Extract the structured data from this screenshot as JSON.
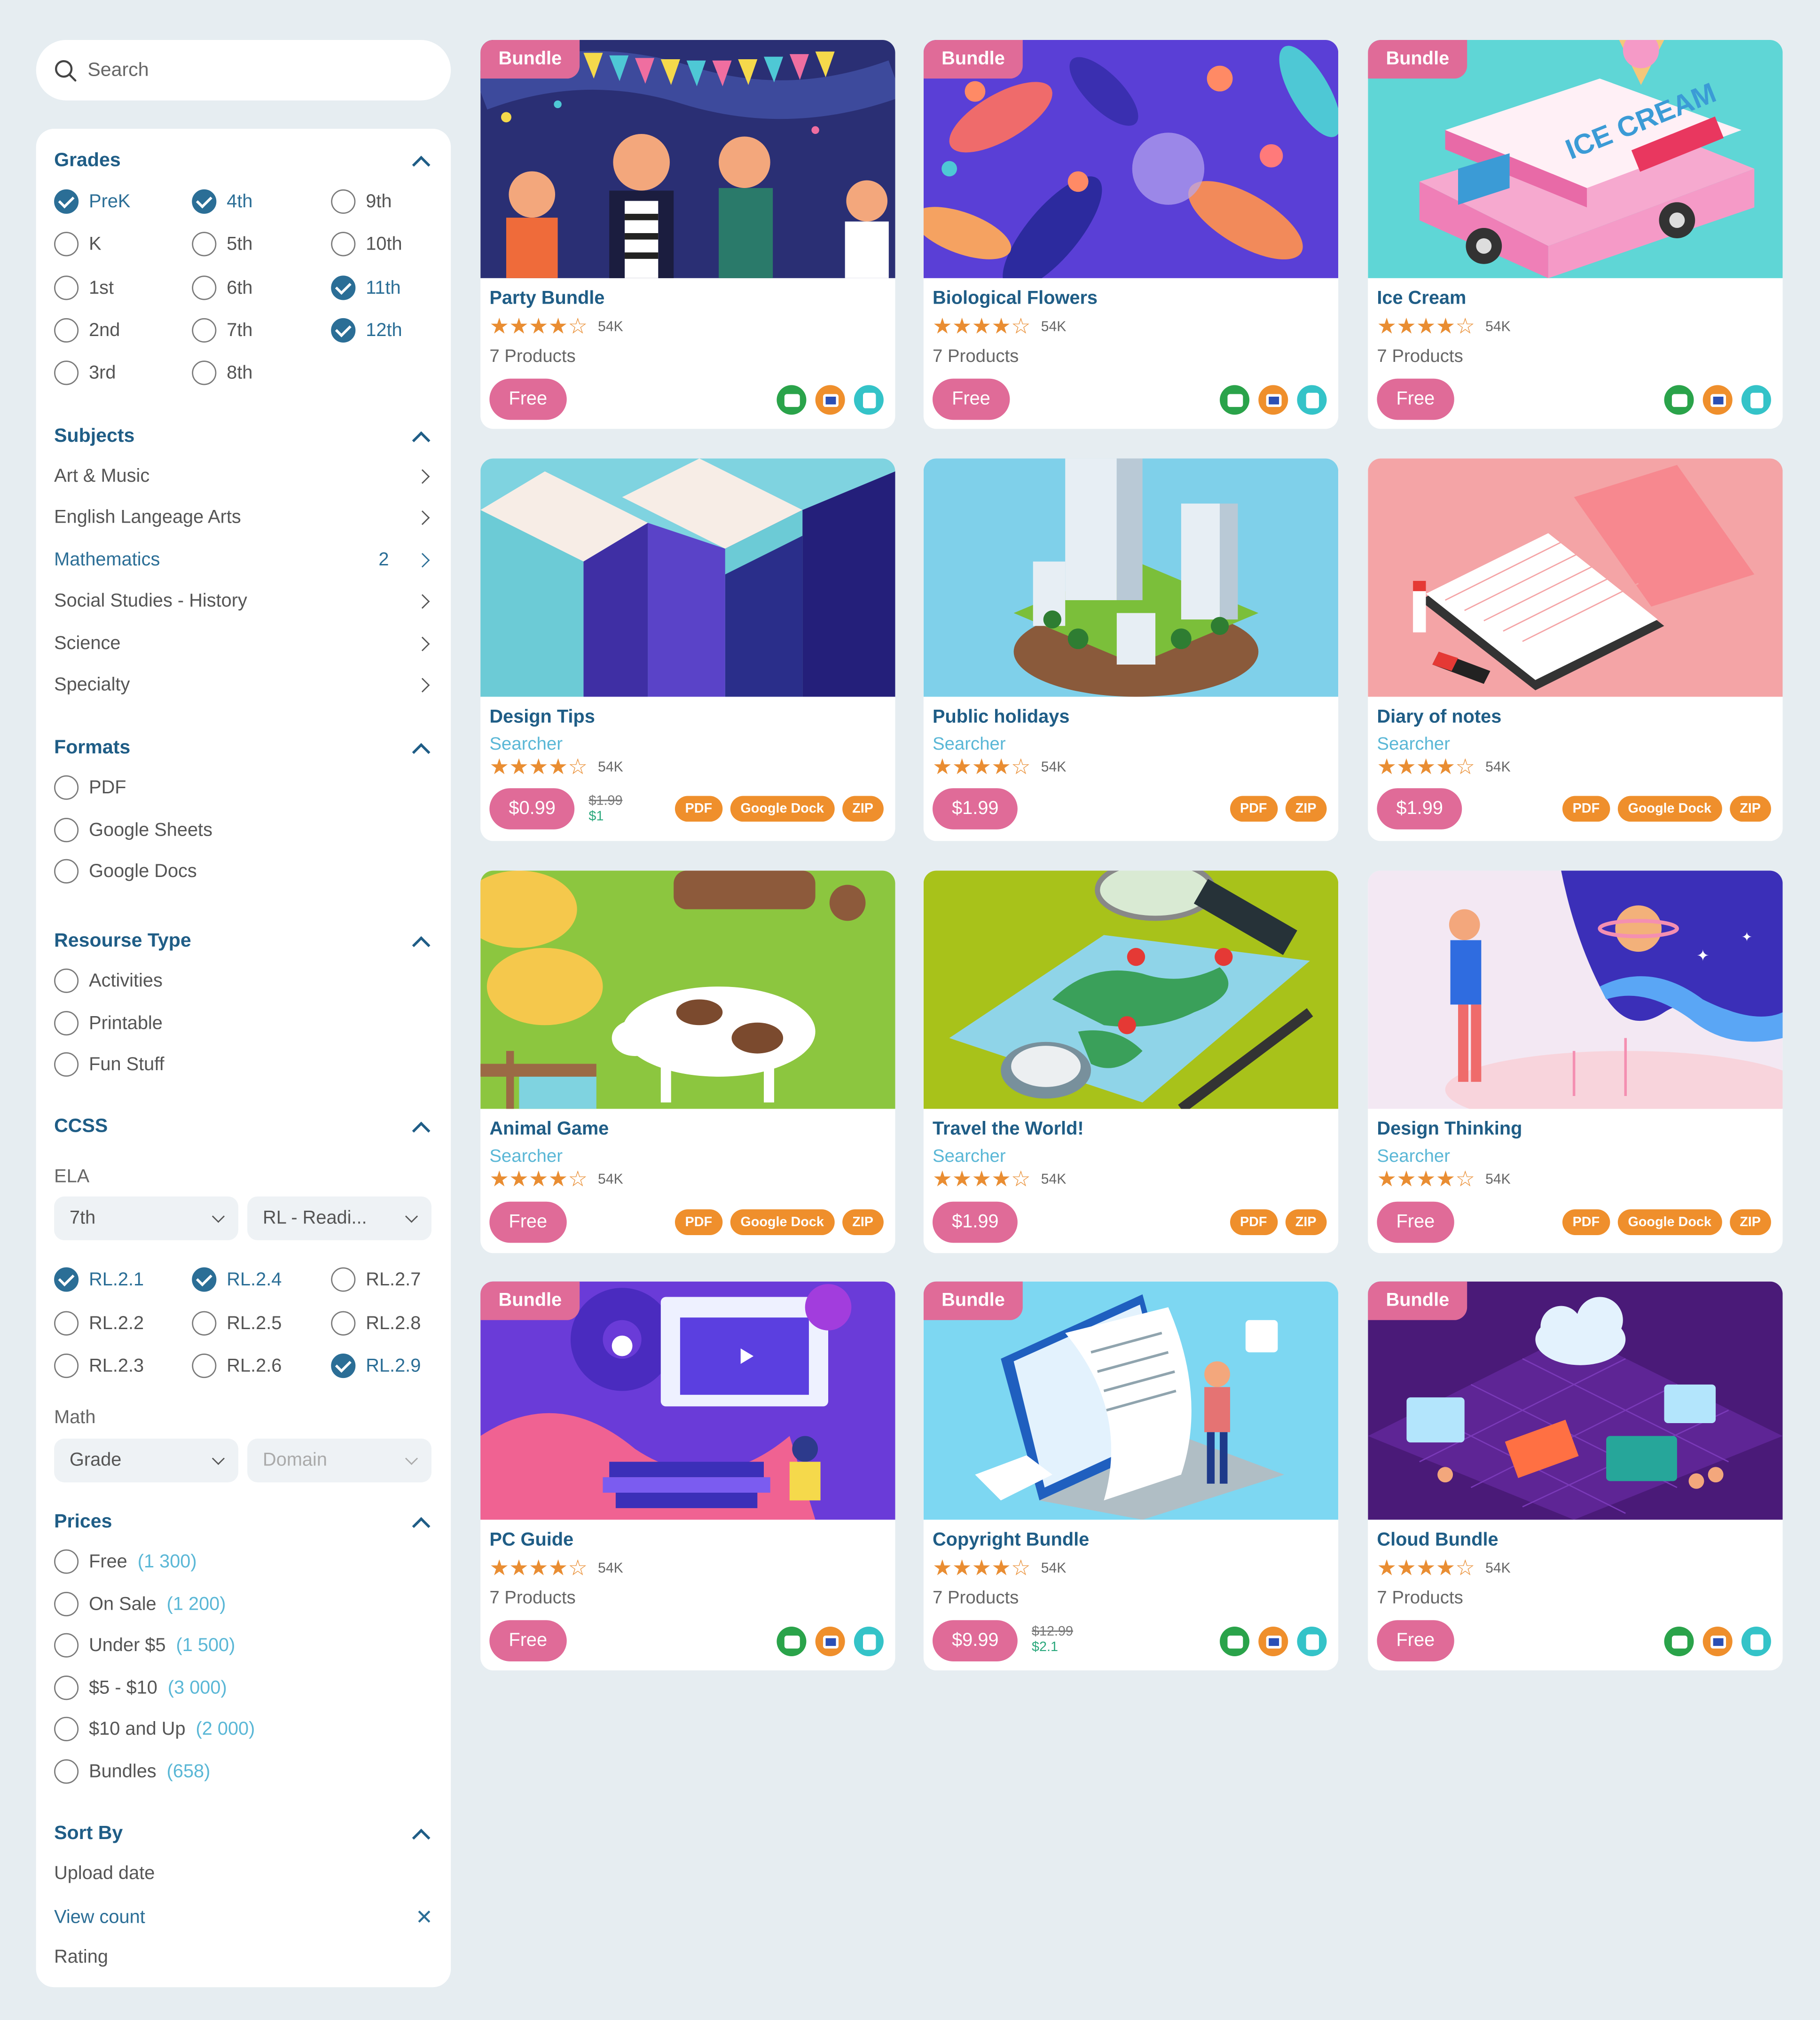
{
  "search": {
    "placeholder": "Search"
  },
  "grades": {
    "title": "Grades",
    "items": [
      {
        "label": "PreK",
        "checked": true
      },
      {
        "label": "K",
        "checked": false
      },
      {
        "label": "1st",
        "checked": false
      },
      {
        "label": "2nd",
        "checked": false
      },
      {
        "label": "3rd",
        "checked": false
      },
      {
        "label": "4th",
        "checked": true
      },
      {
        "label": "5th",
        "checked": false
      },
      {
        "label": "6th",
        "checked": false
      },
      {
        "label": "7th",
        "checked": false
      },
      {
        "label": "8th",
        "checked": false
      },
      {
        "label": "9th",
        "checked": false
      },
      {
        "label": "10th",
        "checked": false
      },
      {
        "label": "11th",
        "checked": true
      },
      {
        "label": "12th",
        "checked": true
      }
    ]
  },
  "subjects": {
    "title": "Subjects",
    "items": [
      {
        "label": "Art & Music",
        "count": ""
      },
      {
        "label": "English Langeage Arts",
        "count": ""
      },
      {
        "label": "Mathematics",
        "count": "2",
        "active": true
      },
      {
        "label": "Social Studies - History",
        "count": ""
      },
      {
        "label": "Science",
        "count": ""
      },
      {
        "label": "Specialty",
        "count": ""
      }
    ]
  },
  "formats": {
    "title": "Formats",
    "items": [
      {
        "label": "PDF"
      },
      {
        "label": "Google Sheets"
      },
      {
        "label": "Google Docs"
      }
    ]
  },
  "resource_type": {
    "title": "Resourse Type",
    "items": [
      {
        "label": "Activities"
      },
      {
        "label": "Printable"
      },
      {
        "label": "Fun Stuff"
      }
    ]
  },
  "ccss": {
    "title": "CCSS",
    "ela_label": "ELA",
    "ela_grade": "7th",
    "ela_domain": "RL - Readi...",
    "items": [
      {
        "label": "RL.2.1",
        "checked": true
      },
      {
        "label": "RL.2.2",
        "checked": false
      },
      {
        "label": "RL.2.3",
        "checked": false
      },
      {
        "label": "RL.2.4",
        "checked": true
      },
      {
        "label": "RL.2.5",
        "checked": false
      },
      {
        "label": "RL.2.6",
        "checked": false
      },
      {
        "label": "RL.2.7",
        "checked": false
      },
      {
        "label": "RL.2.8",
        "checked": false
      },
      {
        "label": "RL.2.9",
        "checked": true
      }
    ],
    "math_label": "Math",
    "math_grade": "Grade",
    "math_domain": "Domain"
  },
  "prices": {
    "title": "Prices",
    "items": [
      {
        "label": "Free",
        "count": "(1 300)"
      },
      {
        "label": "On Sale",
        "count": "(1 200)"
      },
      {
        "label": "Under $5",
        "count": "(1 500)"
      },
      {
        "label": "$5 - $10",
        "count": "(3 000)"
      },
      {
        "label": "$10 and Up",
        "count": "(2 000)"
      },
      {
        "label": "Bundles",
        "count": "(658)"
      }
    ]
  },
  "sort_by": {
    "title": "Sort By",
    "items": [
      {
        "label": "Upload date"
      },
      {
        "label": "View count",
        "active": true
      },
      {
        "label": "Rating"
      }
    ]
  },
  "colors": {
    "accent_pink": "#e06b98",
    "navy": "#1f5d86",
    "teal": "#5ab7d6",
    "orange": "#ef8f2c",
    "page_bg": "#e6edf1"
  },
  "cards": [
    {
      "title": "Party Bundle",
      "badge": "Bundle",
      "rating": "4 of 5",
      "reviews": "54K",
      "products": "7 Products",
      "price": "Free",
      "icons": [
        "presentation-icon",
        "video-icon",
        "document-icon"
      ],
      "image": "party-illustration"
    },
    {
      "title": "Biological Flowers",
      "badge": "Bundle",
      "rating": "4 of 5",
      "reviews": "54K",
      "products": "7 Products",
      "price": "Free",
      "icons": [
        "presentation-icon",
        "video-icon",
        "document-icon"
      ],
      "image": "flowers-illustration"
    },
    {
      "title": "Ice Cream",
      "badge": "Bundle",
      "rating": "4 of 5",
      "reviews": "54K",
      "products": "7 Products",
      "price": "Free",
      "icons": [
        "presentation-icon",
        "video-icon",
        "document-icon"
      ],
      "image": "ice-cream-truck-illustration",
      "image_text": "ICE CREAM"
    },
    {
      "title": "Design Tips",
      "subtitle": "Searcher",
      "rating": "4 of 5",
      "reviews": "54K",
      "price": "$0.99",
      "old_price": "$1.99",
      "saving": "$1",
      "tags": [
        "PDF",
        "Google Dock",
        "ZIP"
      ],
      "image": "blocks-illustration"
    },
    {
      "title": "Public holidays",
      "subtitle": "Searcher",
      "rating": "4 of 5",
      "reviews": "54K",
      "price": "$1.99",
      "tags": [
        "PDF",
        "ZIP"
      ],
      "image": "city-island-illustration"
    },
    {
      "title": "Diary of notes",
      "subtitle": "Searcher",
      "rating": "4 of 5",
      "reviews": "54K",
      "price": "$1.99",
      "tags": [
        "PDF",
        "Google Dock",
        "ZIP"
      ],
      "image": "notebook-illustration"
    },
    {
      "title": "Animal Game",
      "subtitle": "Searcher",
      "rating": "4 of 5",
      "reviews": "54K",
      "price": "Free",
      "tags": [
        "PDF",
        "Google Dock",
        "ZIP"
      ],
      "image": "cows-illustration"
    },
    {
      "title": "Travel the World!",
      "subtitle": "Searcher",
      "rating": "4 of 5",
      "reviews": "54K",
      "price": "$1.99",
      "tags": [
        "PDF",
        "ZIP"
      ],
      "image": "map-illustration"
    },
    {
      "title": "Design Thinking",
      "subtitle": "Searcher",
      "rating": "4 of 5",
      "reviews": "54K",
      "price": "Free",
      "tags": [
        "PDF",
        "Google Dock",
        "ZIP"
      ],
      "image": "space-dream-illustration"
    },
    {
      "title": "PC Guide",
      "badge": "Bundle",
      "rating": "4 of 5",
      "reviews": "54K",
      "products": "7 Products",
      "price": "Free",
      "icons": [
        "presentation-icon",
        "video-icon",
        "document-icon"
      ],
      "image": "pc-guide-illustration"
    },
    {
      "title": "Copyright Bundle",
      "badge": "Bundle",
      "rating": "4 of 5",
      "reviews": "54K",
      "products": "7 Products",
      "price": "$9.99",
      "old_price": "$12.99",
      "saving": "$2.1",
      "icons": [
        "presentation-icon",
        "video-icon",
        "document-icon"
      ],
      "image": "laptop-document-illustration"
    },
    {
      "title": "Cloud Bundle",
      "badge": "Bundle",
      "rating": "4 of 5",
      "reviews": "54K",
      "products": "7 Products",
      "price": "Free",
      "icons": [
        "presentation-icon",
        "video-icon",
        "document-icon"
      ],
      "image": "cloud-network-illustration"
    }
  ]
}
